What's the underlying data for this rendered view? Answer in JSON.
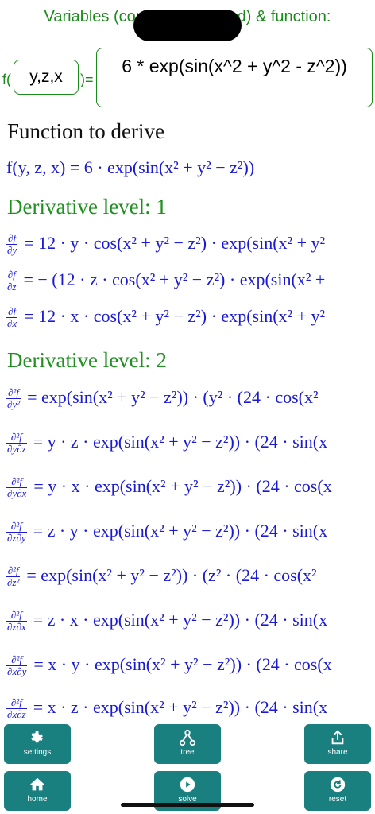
{
  "header": {
    "title": "Variables (comma separated) & function:"
  },
  "inputs": {
    "f_prefix": "f(",
    "f_suffix": ")=",
    "variables": "y,z,x",
    "function": "6 * exp(sin(x^2 + y^2 - z^2))"
  },
  "content": {
    "function_title": "Function to derive",
    "function_expr": "f(y, z, x) = 6 · exp(sin(x² + y² − z²))",
    "levels": [
      {
        "title": "Derivative level: 1",
        "rows": [
          {
            "num": "∂f",
            "den": "∂y",
            "expr": "= 12 · y · cos(x² + y² − z²) · exp(sin(x² + y²"
          },
          {
            "num": "∂f",
            "den": "∂z",
            "expr": "= − (12 · z · cos(x² + y² − z²) · exp(sin(x² +"
          },
          {
            "num": "∂f",
            "den": "∂x",
            "expr": "= 12 · x · cos(x² + y² − z²) · exp(sin(x² + y²"
          }
        ]
      },
      {
        "title": "Derivative level: 2",
        "rows": [
          {
            "num": "∂²f",
            "den": "∂y²",
            "expr": "= exp(sin(x² + y² − z²)) · (y² · (24 · cos(x²"
          },
          {
            "num": "∂²f",
            "den": "∂y∂z",
            "expr": "= y · z · exp(sin(x² + y² − z²)) · (24 · sin(x"
          },
          {
            "num": "∂²f",
            "den": "∂y∂x",
            "expr": "= y · x · exp(sin(x² + y² − z²)) · (24 · cos(x"
          },
          {
            "num": "∂²f",
            "den": "∂z∂y",
            "expr": "= z · y · exp(sin(x² + y² − z²)) · (24 · sin(x"
          },
          {
            "num": "∂²f",
            "den": "∂z²",
            "expr": "= exp(sin(x² + y² − z²)) · (z² · (24 · cos(x²"
          },
          {
            "num": "∂²f",
            "den": "∂z∂x",
            "expr": "= z · x · exp(sin(x² + y² − z²)) · (24 · sin(x"
          },
          {
            "num": "∂²f",
            "den": "∂x∂y",
            "expr": "= x · y · exp(sin(x² + y² − z²)) · (24 · cos(x"
          },
          {
            "num": "∂²f",
            "den": "∂x∂z",
            "expr": "= x · z · exp(sin(x² + y² − z²)) · (24 · sin(x"
          }
        ]
      }
    ]
  },
  "toolbar": {
    "settings": "settings",
    "tree": "tree",
    "share": "share",
    "home": "home",
    "solve": "solve",
    "reset": "reset",
    "icons": [
      "gear-icon",
      "tree-icon",
      "share-icon",
      "home-icon",
      "play-icon",
      "reset-icon"
    ]
  },
  "colors": {
    "accent": "#1a8a1a",
    "math": "#1a1ad6",
    "button": "#1a7f7f"
  }
}
